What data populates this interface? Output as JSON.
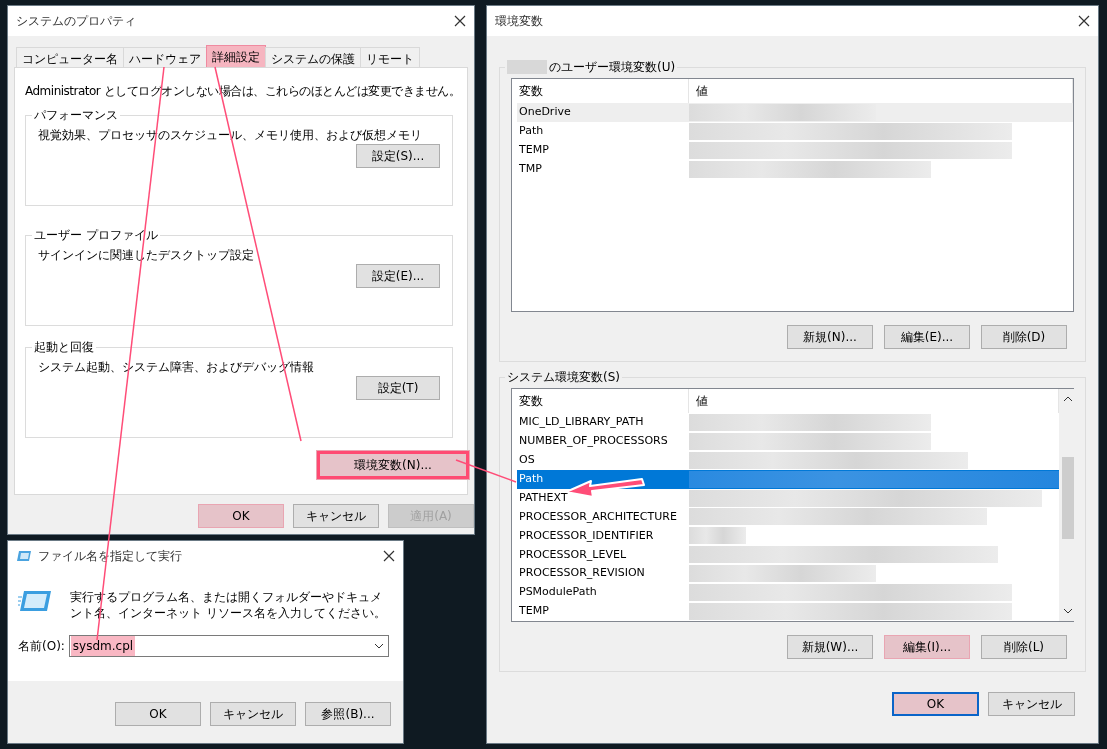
{
  "system_properties": {
    "title": "システムのプロパティ",
    "tabs": [
      {
        "label": "コンピューター名",
        "selected": false,
        "highlighted": false
      },
      {
        "label": "ハードウェア",
        "selected": false,
        "highlighted": false
      },
      {
        "label": "詳細設定",
        "selected": true,
        "highlighted": true
      },
      {
        "label": "システムの保護",
        "selected": false,
        "highlighted": false
      },
      {
        "label": "リモート",
        "selected": false,
        "highlighted": false
      }
    ],
    "notice": "Administrator としてログオンしない場合は、これらのほとんどは変更できません。",
    "groups": [
      {
        "title": "パフォーマンス",
        "description": "視覚効果、プロセッサのスケジュール、メモリ使用、および仮想メモリ",
        "button": "設定(S)..."
      },
      {
        "title": "ユーザー プロファイル",
        "description": "サインインに関連したデスクトップ設定",
        "button": "設定(E)..."
      },
      {
        "title": "起動と回復",
        "description": "システム起動、システム障害、およびデバッグ情報",
        "button": "設定(T)"
      }
    ],
    "env_button": {
      "label": "環境変数(N)...",
      "highlighted": true
    },
    "buttons": [
      {
        "label": "OK",
        "highlighted": true,
        "disabled": false
      },
      {
        "label": "キャンセル",
        "highlighted": false,
        "disabled": false
      },
      {
        "label": "適用(A)",
        "highlighted": false,
        "disabled": true
      }
    ]
  },
  "run_dialog": {
    "title": "ファイル名を指定して実行",
    "message": "実行するプログラム名、または開くフォルダーやドキュメント名、インターネット リソース名を入力してください。",
    "field_label": "名前(O):",
    "field_value": "sysdm.cpl",
    "value_highlighted": true,
    "buttons": [
      {
        "label": "OK"
      },
      {
        "label": "キャンセル"
      },
      {
        "label": "参照(B)..."
      }
    ]
  },
  "env_vars": {
    "title": "環境変数",
    "sections": [
      {
        "title": "のユーザー環境変数(U)",
        "name_redacted": true,
        "columns": [
          "変数",
          "値"
        ],
        "focused": false,
        "rows": [
          {
            "name": "OneDrive",
            "selected": true
          },
          {
            "name": "Path",
            "selected": false
          },
          {
            "name": "TEMP",
            "selected": false
          },
          {
            "name": "TMP",
            "selected": false
          }
        ],
        "buttons": [
          {
            "label": "新規(N)...",
            "highlighted": false
          },
          {
            "label": "編集(E)...",
            "highlighted": false
          },
          {
            "label": "削除(D)",
            "highlighted": false
          }
        ]
      },
      {
        "title": "システム環境変数(S)",
        "name_redacted": false,
        "columns": [
          "変数",
          "値"
        ],
        "focused": true,
        "rows": [
          {
            "name": "MIC_LD_LIBRARY_PATH",
            "selected": false
          },
          {
            "name": "NUMBER_OF_PROCESSORS",
            "selected": false
          },
          {
            "name": "OS",
            "selected": false
          },
          {
            "name": "Path",
            "selected": true
          },
          {
            "name": "PATHEXT",
            "selected": false
          },
          {
            "name": "PROCESSOR_ARCHITECTURE",
            "selected": false
          },
          {
            "name": "PROCESSOR_IDENTIFIER",
            "selected": false
          },
          {
            "name": "PROCESSOR_LEVEL",
            "selected": false
          },
          {
            "name": "PROCESSOR_REVISION",
            "selected": false
          },
          {
            "name": "PSModulePath",
            "selected": false
          },
          {
            "name": "TEMP",
            "selected": false
          }
        ],
        "buttons": [
          {
            "label": "新規(W)...",
            "highlighted": false
          },
          {
            "label": "編集(I)...",
            "highlighted": true
          },
          {
            "label": "削除(L)",
            "highlighted": false
          }
        ]
      }
    ],
    "buttons": [
      {
        "label": "OK",
        "highlighted": true,
        "default": true
      },
      {
        "label": "キャンセル",
        "highlighted": false,
        "default": false
      }
    ]
  }
}
